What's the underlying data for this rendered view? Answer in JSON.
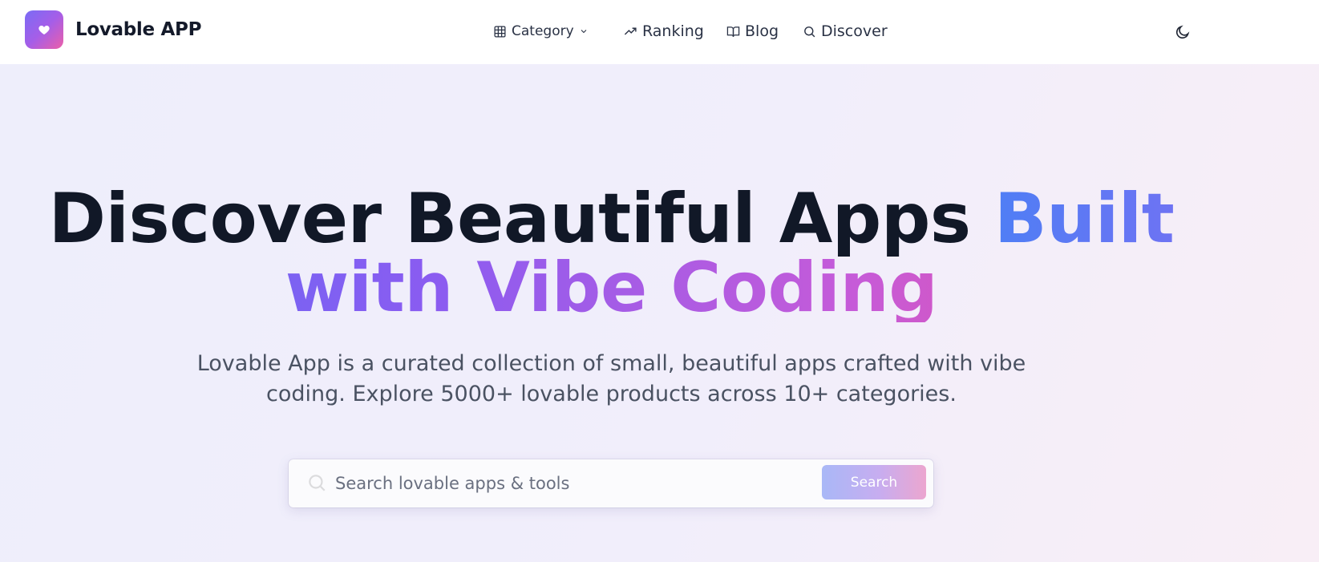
{
  "brand": {
    "name": "Lovable APP",
    "logo_icon": "heart-icon"
  },
  "nav": {
    "category": {
      "label": "Category",
      "icon": "grid-icon"
    },
    "ranking": {
      "label": "Ranking",
      "icon": "trending-up-icon"
    },
    "blog": {
      "label": "Blog",
      "icon": "book-open-icon"
    },
    "discover": {
      "label": "Discover",
      "icon": "search-icon"
    }
  },
  "theme_toggle": {
    "icon": "moon-icon"
  },
  "hero": {
    "headline_line1_dark": "Discover Beautiful Apps ",
    "headline_line1_accent": "Built",
    "headline_line2": "with Vibe Coding",
    "subtitle_line1": "Lovable App is a curated collection of small, beautiful apps crafted with vibe",
    "subtitle_line2": "coding. Explore 5000+ lovable products across 10+ categories."
  },
  "search": {
    "placeholder": "Search lovable apps & tools",
    "value": "",
    "button_label": "Search"
  },
  "colors": {
    "brand_gradient_start": "#7a6cf5",
    "brand_gradient_end": "#ec5fa8",
    "accent_blue": "#4f7ef5",
    "accent_pink": "#ec4f9c",
    "text_dark": "#111827"
  }
}
